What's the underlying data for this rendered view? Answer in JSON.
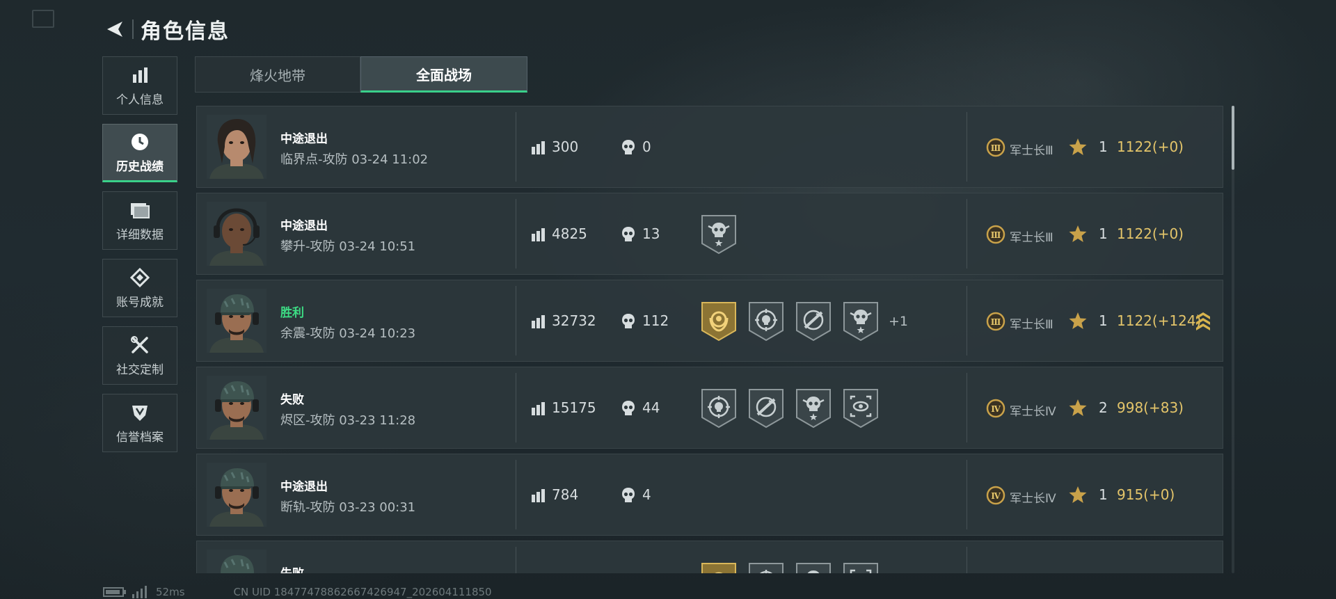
{
  "header": {
    "title": "角色信息"
  },
  "sidebar": {
    "items": [
      {
        "label": "个人信息",
        "icon": "bar-chart-icon"
      },
      {
        "label": "历史战绩",
        "icon": "clock-icon",
        "active": true
      },
      {
        "label": "详细数据",
        "icon": "folder-icon"
      },
      {
        "label": "账号成就",
        "icon": "achievement-icon"
      },
      {
        "label": "社交定制",
        "icon": "tools-icon"
      },
      {
        "label": "信誉档案",
        "icon": "credit-shield-icon"
      }
    ]
  },
  "tabs": [
    {
      "label": "烽火地带",
      "active": false
    },
    {
      "label": "全面战场",
      "active": true
    }
  ],
  "matches": [
    {
      "status": "中途退出",
      "result": "quit",
      "detail": "临界点-攻防 03-24 11:02",
      "score": "300",
      "kills": "0",
      "badges": [],
      "more": "",
      "rank": "军士长Ⅲ",
      "rank_tier": "Ⅲ",
      "stars": "1",
      "rating": "1122(+0)",
      "promoted": false,
      "avatar": "female-operator"
    },
    {
      "status": "中途退出",
      "result": "quit",
      "detail": "攀升-攻防 03-24 10:51",
      "score": "4825",
      "kills": "13",
      "badges": [
        "skull-star-badge"
      ],
      "more": "",
      "rank": "军士长Ⅲ",
      "rank_tier": "Ⅲ",
      "stars": "1",
      "rating": "1122(+0)",
      "promoted": false,
      "avatar": "bald-operator"
    },
    {
      "status": "胜利",
      "result": "win",
      "detail": "余震-攻防 03-24 10:23",
      "score": "32732",
      "kills": "112",
      "badges": [
        "gold-laurel-badge",
        "skull-target-badge",
        "rifle-target-badge",
        "skull-star-badge"
      ],
      "more": "+1",
      "rank": "军士长Ⅲ",
      "rank_tier": "Ⅲ",
      "stars": "1",
      "rating": "1122(+124)",
      "promoted": true,
      "avatar": "cap-operator"
    },
    {
      "status": "失败",
      "result": "loss",
      "detail": "烬区-攻防 03-23 11:28",
      "score": "15175",
      "kills": "44",
      "badges": [
        "skull-target-badge",
        "rifle-target-badge",
        "skull-star-badge",
        "eye-scope-badge"
      ],
      "more": "",
      "rank": "军士长Ⅳ",
      "rank_tier": "Ⅳ",
      "stars": "2",
      "rating": "998(+83)",
      "promoted": false,
      "avatar": "cap-operator"
    },
    {
      "status": "中途退出",
      "result": "quit",
      "detail": "断轨-攻防 03-23 00:31",
      "score": "784",
      "kills": "4",
      "badges": [],
      "more": "",
      "rank": "军士长Ⅳ",
      "rank_tier": "Ⅳ",
      "stars": "1",
      "rating": "915(+0)",
      "promoted": false,
      "avatar": "cap-operator"
    },
    {
      "status": "失败",
      "result": "loss",
      "detail": "",
      "score": "",
      "kills": "",
      "badges": [
        "gold-laurel-badge",
        "skull-target-badge",
        "skull-star-badge",
        "eye-scope-badge"
      ],
      "more": "",
      "rank": "",
      "rank_tier": "",
      "stars": "",
      "rating": "",
      "promoted": false,
      "avatar": "cap-operator"
    }
  ],
  "footer": {
    "fps": "52ms",
    "uid": "CN UID 184774788626674269​47_202604111850"
  },
  "colors": {
    "accent": "#3ad08a",
    "win": "#3ddc84",
    "rating": "#e4c56a",
    "gold": "#c9a24a"
  }
}
